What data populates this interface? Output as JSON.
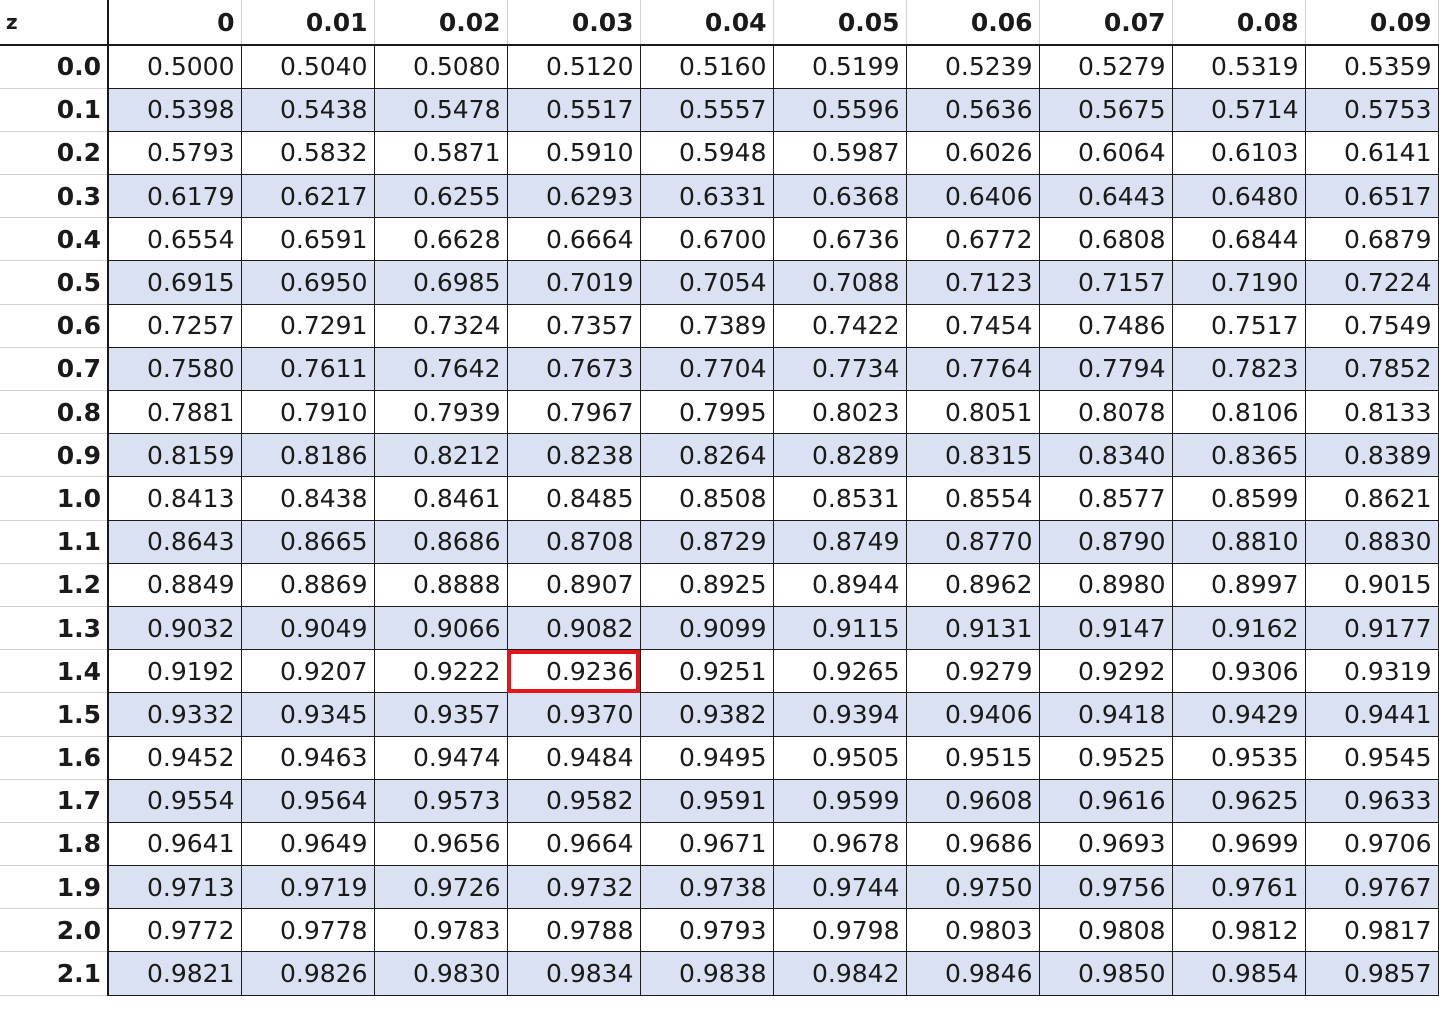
{
  "table": {
    "corner_label": "z",
    "columns": [
      "0",
      "0.01",
      "0.02",
      "0.03",
      "0.04",
      "0.05",
      "0.06",
      "0.07",
      "0.08",
      "0.09"
    ],
    "highlight_color": "#e8141c",
    "stripe_color": "#d9e1f2",
    "highlighted_cell": {
      "row": 14,
      "col": 3
    },
    "rows": [
      {
        "z": "0.0",
        "values": [
          "0.5000",
          "0.5040",
          "0.5080",
          "0.5120",
          "0.5160",
          "0.5199",
          "0.5239",
          "0.5279",
          "0.5319",
          "0.5359"
        ]
      },
      {
        "z": "0.1",
        "values": [
          "0.5398",
          "0.5438",
          "0.5478",
          "0.5517",
          "0.5557",
          "0.5596",
          "0.5636",
          "0.5675",
          "0.5714",
          "0.5753"
        ]
      },
      {
        "z": "0.2",
        "values": [
          "0.5793",
          "0.5832",
          "0.5871",
          "0.5910",
          "0.5948",
          "0.5987",
          "0.6026",
          "0.6064",
          "0.6103",
          "0.6141"
        ]
      },
      {
        "z": "0.3",
        "values": [
          "0.6179",
          "0.6217",
          "0.6255",
          "0.6293",
          "0.6331",
          "0.6368",
          "0.6406",
          "0.6443",
          "0.6480",
          "0.6517"
        ]
      },
      {
        "z": "0.4",
        "values": [
          "0.6554",
          "0.6591",
          "0.6628",
          "0.6664",
          "0.6700",
          "0.6736",
          "0.6772",
          "0.6808",
          "0.6844",
          "0.6879"
        ]
      },
      {
        "z": "0.5",
        "values": [
          "0.6915",
          "0.6950",
          "0.6985",
          "0.7019",
          "0.7054",
          "0.7088",
          "0.7123",
          "0.7157",
          "0.7190",
          "0.7224"
        ]
      },
      {
        "z": "0.6",
        "values": [
          "0.7257",
          "0.7291",
          "0.7324",
          "0.7357",
          "0.7389",
          "0.7422",
          "0.7454",
          "0.7486",
          "0.7517",
          "0.7549"
        ]
      },
      {
        "z": "0.7",
        "values": [
          "0.7580",
          "0.7611",
          "0.7642",
          "0.7673",
          "0.7704",
          "0.7734",
          "0.7764",
          "0.7794",
          "0.7823",
          "0.7852"
        ]
      },
      {
        "z": "0.8",
        "values": [
          "0.7881",
          "0.7910",
          "0.7939",
          "0.7967",
          "0.7995",
          "0.8023",
          "0.8051",
          "0.8078",
          "0.8106",
          "0.8133"
        ]
      },
      {
        "z": "0.9",
        "values": [
          "0.8159",
          "0.8186",
          "0.8212",
          "0.8238",
          "0.8264",
          "0.8289",
          "0.8315",
          "0.8340",
          "0.8365",
          "0.8389"
        ]
      },
      {
        "z": "1.0",
        "values": [
          "0.8413",
          "0.8438",
          "0.8461",
          "0.8485",
          "0.8508",
          "0.8531",
          "0.8554",
          "0.8577",
          "0.8599",
          "0.8621"
        ]
      },
      {
        "z": "1.1",
        "values": [
          "0.8643",
          "0.8665",
          "0.8686",
          "0.8708",
          "0.8729",
          "0.8749",
          "0.8770",
          "0.8790",
          "0.8810",
          "0.8830"
        ]
      },
      {
        "z": "1.2",
        "values": [
          "0.8849",
          "0.8869",
          "0.8888",
          "0.8907",
          "0.8925",
          "0.8944",
          "0.8962",
          "0.8980",
          "0.8997",
          "0.9015"
        ]
      },
      {
        "z": "1.3",
        "values": [
          "0.9032",
          "0.9049",
          "0.9066",
          "0.9082",
          "0.9099",
          "0.9115",
          "0.9131",
          "0.9147",
          "0.9162",
          "0.9177"
        ]
      },
      {
        "z": "1.4",
        "values": [
          "0.9192",
          "0.9207",
          "0.9222",
          "0.9236",
          "0.9251",
          "0.9265",
          "0.9279",
          "0.9292",
          "0.9306",
          "0.9319"
        ]
      },
      {
        "z": "1.5",
        "values": [
          "0.9332",
          "0.9345",
          "0.9357",
          "0.9370",
          "0.9382",
          "0.9394",
          "0.9406",
          "0.9418",
          "0.9429",
          "0.9441"
        ]
      },
      {
        "z": "1.6",
        "values": [
          "0.9452",
          "0.9463",
          "0.9474",
          "0.9484",
          "0.9495",
          "0.9505",
          "0.9515",
          "0.9525",
          "0.9535",
          "0.9545"
        ]
      },
      {
        "z": "1.7",
        "values": [
          "0.9554",
          "0.9564",
          "0.9573",
          "0.9582",
          "0.9591",
          "0.9599",
          "0.9608",
          "0.9616",
          "0.9625",
          "0.9633"
        ]
      },
      {
        "z": "1.8",
        "values": [
          "0.9641",
          "0.9649",
          "0.9656",
          "0.9664",
          "0.9671",
          "0.9678",
          "0.9686",
          "0.9693",
          "0.9699",
          "0.9706"
        ]
      },
      {
        "z": "1.9",
        "values": [
          "0.9713",
          "0.9719",
          "0.9726",
          "0.9732",
          "0.9738",
          "0.9744",
          "0.9750",
          "0.9756",
          "0.9761",
          "0.9767"
        ]
      },
      {
        "z": "2.0",
        "values": [
          "0.9772",
          "0.9778",
          "0.9783",
          "0.9788",
          "0.9793",
          "0.9798",
          "0.9803",
          "0.9808",
          "0.9812",
          "0.9817"
        ]
      },
      {
        "z": "2.1",
        "values": [
          "0.9821",
          "0.9826",
          "0.9830",
          "0.9834",
          "0.9838",
          "0.9842",
          "0.9846",
          "0.9850",
          "0.9854",
          "0.9857"
        ]
      }
    ]
  }
}
